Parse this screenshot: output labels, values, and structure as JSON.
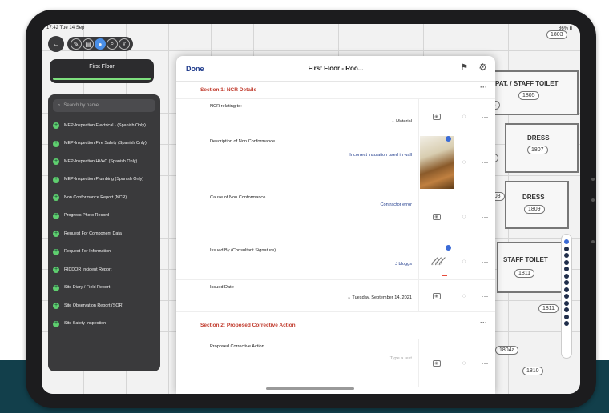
{
  "status_bar": {
    "time": "17:42  Tue 14 Sep",
    "battery": "86% ▮"
  },
  "toolbar": {
    "back_icon": "back-arrow-icon",
    "tools": [
      "pen-icon",
      "layers-icon",
      "pin-icon",
      "search-icon",
      "share-icon"
    ]
  },
  "floor": {
    "label": "First Floor"
  },
  "sidebar": {
    "search_placeholder": "Search by name",
    "items": [
      {
        "label": "MEP-Inspection Electrical - (Spanish Only)"
      },
      {
        "label": "MEP-Inspection Fire Safety (Spanish Only)"
      },
      {
        "label": "MEP-Inspection HVAC (Spanish Only)"
      },
      {
        "label": "MEP-Inspection Plumbing (Spanish Only)"
      },
      {
        "label": "Non Conformance Report (NCR)"
      },
      {
        "label": "Progress Photo Record"
      },
      {
        "label": "Request For Component Data"
      },
      {
        "label": "Request For Information"
      },
      {
        "label": "RIDDOR Incident Report"
      },
      {
        "label": "Site Diary / Field Report"
      },
      {
        "label": "Site Observation Report (SOR)"
      },
      {
        "label": "Site Safety Inspection"
      }
    ]
  },
  "drawing": {
    "rooms": [
      "PAT. / STAFF TOILET",
      "DRESS",
      "DRESS",
      "STAFF TOILET"
    ],
    "room_numbers": [
      "1805",
      "1807",
      "1809",
      "1811"
    ],
    "tags": [
      "1803",
      "1806",
      "1807",
      "1808",
      "1811",
      "1804a",
      "1810"
    ]
  },
  "modal": {
    "done_label": "Done",
    "title": "First Floor - Roo...",
    "flag_icon": "flag-icon",
    "settings_icon": "gear-icon",
    "section1": "Section 1: NCR Details",
    "section2": "Section 2: Proposed Corrective Action",
    "rows": [
      {
        "label": "NCR relating to:",
        "value": "Material"
      },
      {
        "label": "Description of Non Conformance",
        "value": "Incorrect insulation used in wall"
      },
      {
        "label": "Cause of Non Conformance",
        "value": "Contractor error"
      },
      {
        "label": "Issued By (Consultant Signature)",
        "value": "J bloggs"
      },
      {
        "label": "Issued Date",
        "value": "Tuesday, September 14, 2021"
      },
      {
        "label": "Proposed Corrective Action",
        "value": "Type a text"
      }
    ]
  }
}
